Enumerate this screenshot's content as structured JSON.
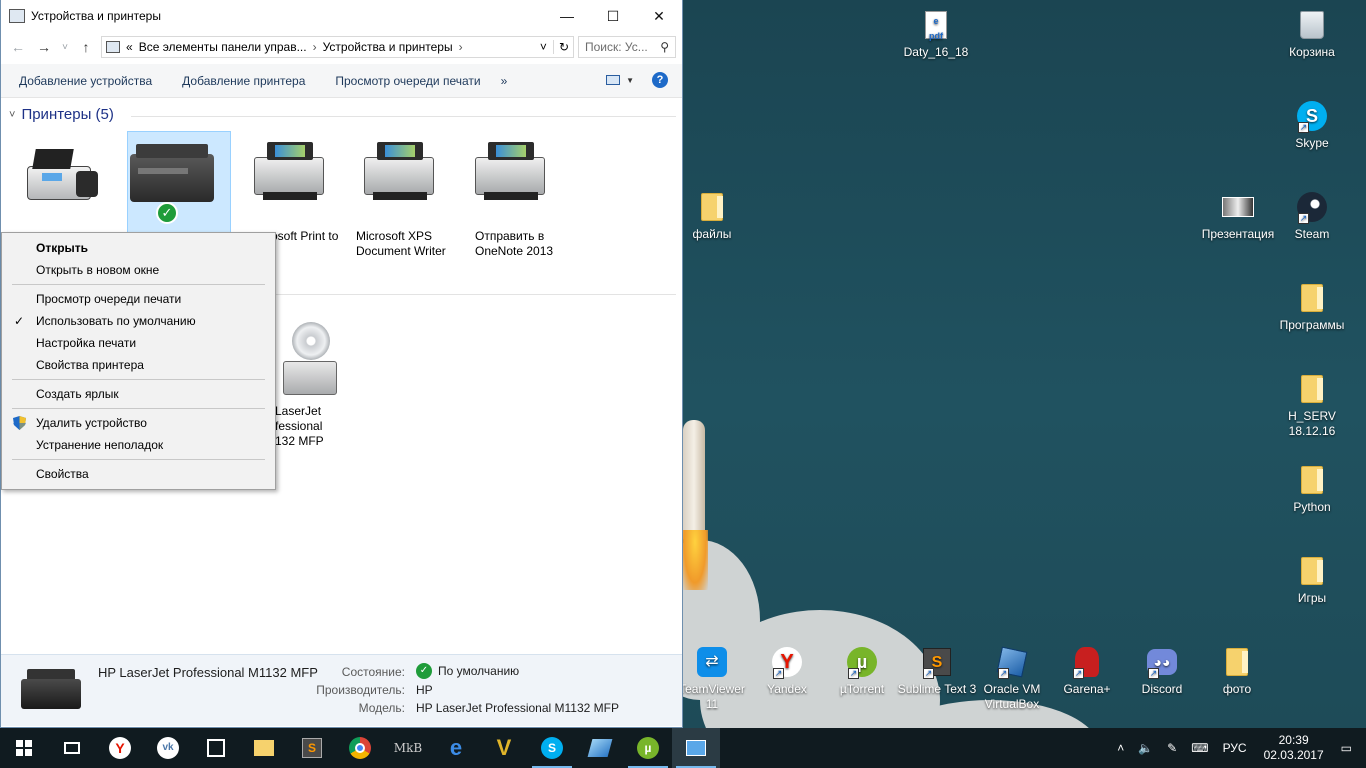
{
  "window": {
    "title": "Устройства и принтеры",
    "minimize": "—",
    "maximize": "☐",
    "close": "✕"
  },
  "address": {
    "back": "←",
    "forward": "→",
    "recent": "˅",
    "up": "↑",
    "chevrons": "«",
    "crumb1": "Все элементы панели управ...",
    "crumb2": "Устройства и принтеры",
    "sep": "›",
    "dropdown": "˅",
    "refresh": "↻",
    "search_placeholder": "Поиск: Ус..."
  },
  "commands": {
    "add_device": "Добавление устройства",
    "add_printer": "Добавление принтера",
    "print_queue": "Просмотр очереди печати",
    "more": "»",
    "help": "?"
  },
  "group": {
    "chevron": "˅",
    "title": "Принтеры (5)"
  },
  "devices": [
    {
      "name": ""
    },
    {
      "name": ""
    },
    {
      "name": "osoft Print to"
    },
    {
      "name": "Microsoft XPS Document Writer"
    },
    {
      "name": "Отправить в OneNote 2013"
    }
  ],
  "second_device": {
    "name": "LaserJet\nfessional\n132 MFP"
  },
  "context_menu": {
    "open": "Открыть",
    "open_new": "Открыть в новом окне",
    "queue": "Просмотр очереди печати",
    "default": "Использовать по умолчанию",
    "print_settings": "Настройка печати",
    "printer_props": "Свойства принтера",
    "shortcut": "Создать ярлык",
    "remove": "Удалить устройство",
    "troubleshoot": "Устранение неполадок",
    "properties": "Свойства",
    "checkmark": "✓"
  },
  "details": {
    "name": "HP LaserJet Professional M1132 MFP",
    "state_label": "Состояние:",
    "state_value": "По умолчанию",
    "maker_label": "Производитель:",
    "maker_value": "HP",
    "model_label": "Модель:",
    "model_value": "HP LaserJet Professional M1132 MFP"
  },
  "desktop_icons": {
    "daty": "Daty_16_18",
    "trash": "Корзина",
    "skype": "Skype",
    "files": "файлы",
    "presentation": "Презентация",
    "steam": "Steam",
    "programs": "Программы",
    "hserv": "H_SERV 18.12.16",
    "python": "Python",
    "games": "Игры",
    "teamviewer": "TeamViewer 11",
    "yandex": "Yandex",
    "utorrent": "µTorrent",
    "sublime": "Sublime Text 3",
    "virtualbox": "Oracle VM VirtualBox",
    "garena": "Garena+",
    "discord": "Discord",
    "photo": "фото"
  },
  "tray": {
    "lang": "РУС",
    "time": "20:39",
    "date": "02.03.2017"
  },
  "colors": {
    "accent": "#1e6ac8",
    "desktop_bg": "#1f4a56",
    "taskbar_bg": "#101b20"
  }
}
